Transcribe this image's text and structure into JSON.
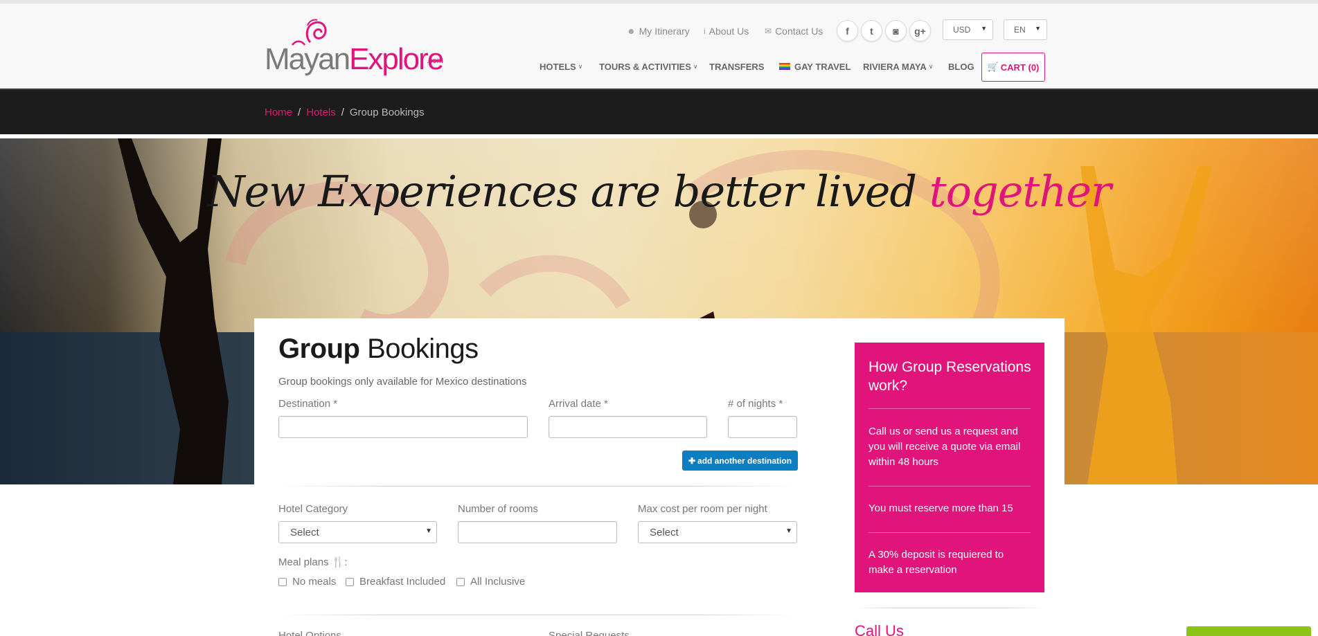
{
  "brand": {
    "name_part1": "Mayan",
    "name_part2": "Explore",
    "suffix": ".com"
  },
  "toplinks": [
    {
      "icon": "user-icon",
      "label": "My Itinerary"
    },
    {
      "icon": "info-icon",
      "label": "About Us"
    },
    {
      "icon": "envelope-icon",
      "label": "Contact Us"
    }
  ],
  "social": [
    {
      "name": "facebook-icon",
      "glyph": "f"
    },
    {
      "name": "twitter-icon",
      "glyph": "t"
    },
    {
      "name": "instagram-icon",
      "glyph": "◙"
    },
    {
      "name": "google-plus-icon",
      "glyph": "g+"
    }
  ],
  "currency": {
    "selected": "USD"
  },
  "language": {
    "selected": "EN"
  },
  "nav": [
    {
      "label": "HOTELS",
      "dropdown": true
    },
    {
      "label": "TOURS & ACTIVITIES",
      "dropdown": true
    },
    {
      "label": "TRANSFERS",
      "dropdown": false
    },
    {
      "label": "GAY TRAVEL",
      "dropdown": false,
      "flag": true
    },
    {
      "label": "RIVIERA MAYA",
      "dropdown": true
    },
    {
      "label": "BLOG",
      "dropdown": false
    }
  ],
  "cart": {
    "label": "CART (0)",
    "icon": "cart-icon"
  },
  "breadcrumb": [
    {
      "label": "Home",
      "link": true
    },
    {
      "label": "Hotels",
      "link": true
    },
    {
      "label": "Group Bookings",
      "link": false
    }
  ],
  "hero": {
    "tagline_main": "New Experiences are better lived",
    "tagline_accent": "together"
  },
  "form": {
    "title_bold": "Group",
    "title_light": "Bookings",
    "intro": "Group bookings only available for Mexico destinations",
    "destination_label": "Destination *",
    "arrival_label": "Arrival date *",
    "nights_label": "# of nights *",
    "destination_value": "",
    "arrival_value": "",
    "nights_value": "",
    "add_destination": "add another destination",
    "hotel_category_label": "Hotel Category",
    "hotel_category_value": "Select",
    "rooms_label": "Number of rooms",
    "rooms_value": "",
    "max_cost_label": "Max cost per room per night",
    "max_cost_value": "Select",
    "meal_label": "Meal plans",
    "meals": [
      "No meals",
      "Breakfast Included",
      "All Inclusive"
    ],
    "bottom_label_1": "Hotel Options",
    "bottom_label_2": "Special Requests"
  },
  "sidebar": {
    "title": "How Group Reservations work?",
    "points": [
      "Call us or send us a request and you will receive a quote via email within 48 hours",
      "You must reserve more than 15",
      "A 30% deposit is requiered to make a reservation"
    ]
  },
  "call_us": "Call Us",
  "colors": {
    "accent": "#e0147a",
    "button_blue": "#0d7fc1",
    "dark_bar": "#1c1c1c"
  }
}
